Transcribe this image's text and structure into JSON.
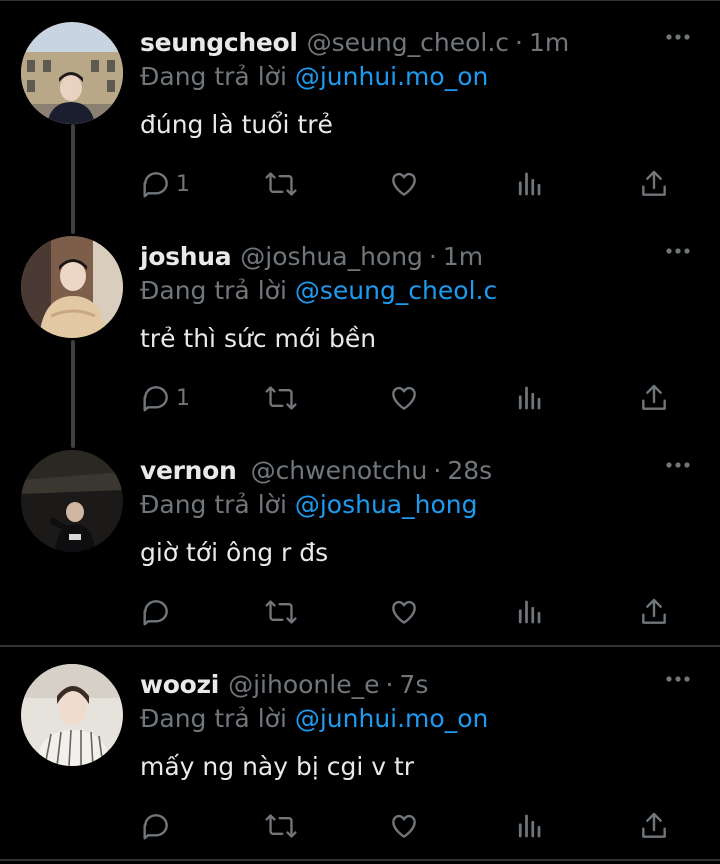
{
  "colors": {
    "background": "#000000",
    "text": "#e7e9ea",
    "secondary": "#71767b",
    "mention": "#1d9bf0",
    "divider": "#2f3336"
  },
  "tweets": [
    {
      "name": "seungcheol",
      "handle": "@seung_cheol.c",
      "time": "1m",
      "reply_prefix": "Đang trả lời",
      "reply_to": "@junhui.mo_on",
      "text": "đúng là tuổi trẻ",
      "replies": "1",
      "avatar_icon": "avatar-photo"
    },
    {
      "name": "joshua",
      "handle": "@joshua_hong",
      "time": "1m",
      "reply_prefix": "Đang trả lời",
      "reply_to": "@seung_cheol.c",
      "text": "trẻ thì sức mới bền",
      "replies": "1",
      "avatar_icon": "avatar-photo"
    },
    {
      "name": "vernon",
      "handle": "@chwenotchu",
      "time": "28s",
      "reply_prefix": "Đang trả lời",
      "reply_to": "@joshua_hong",
      "text": "giờ tới ông r đs",
      "replies": "",
      "avatar_icon": "avatar-photo"
    },
    {
      "name": "woozi",
      "handle": "@jihoonle_e",
      "time": "7s",
      "reply_prefix": "Đang trả lời",
      "reply_to": "@junhui.mo_on",
      "text": "mấy ng này bị cgi v tr",
      "replies": "",
      "avatar_icon": "avatar-photo"
    }
  ],
  "separator": "·",
  "icons": [
    "reply-icon",
    "retweet-icon",
    "like-icon",
    "analytics-icon",
    "share-icon",
    "more-options-icon"
  ]
}
